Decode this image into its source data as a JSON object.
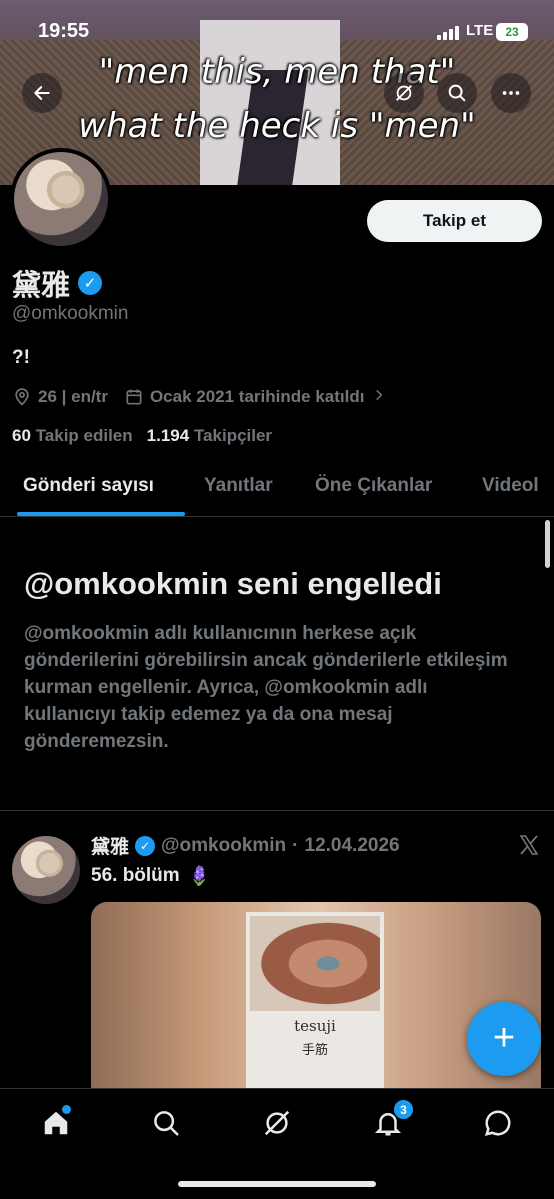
{
  "status_bar": {
    "time": "19:55",
    "network": "LTE",
    "battery": "23"
  },
  "banner": {
    "caption_line1": "\"men this, men that\"",
    "caption_line2": "what the heck is \"men\""
  },
  "profile": {
    "display_name": "黛雅",
    "handle": "@omkookmin",
    "bio": "?!",
    "location": "26 | en/tr",
    "joined": "Ocak 2021 tarihinde katıldı",
    "following_count": "60",
    "following_label": "Takip edilen",
    "followers_count": "1.194",
    "followers_label": "Takipçiler",
    "follow_button": "Takip et"
  },
  "tabs": [
    {
      "label": "Gönderi sayısı",
      "active": true
    },
    {
      "label": "Yanıtlar",
      "active": false
    },
    {
      "label": "Öne Çıkanlar",
      "active": false
    },
    {
      "label": "Videol",
      "active": false
    }
  ],
  "blocked": {
    "title": "@omkookmin seni engelledi",
    "body": "@omkookmin adlı kullanıcının herkese açık gönderilerini görebilirsin ancak gönderilerle etkileşim kurman engellenir. Ayrıca, @omkookmin adlı kullanıcıyı takip edemez ya da ona mesaj gönderemezsin."
  },
  "post": {
    "author_name": "黛雅",
    "author_handle": "@omkookmin",
    "separator": "·",
    "date": "12.04.2026",
    "text": "56. bölüm",
    "emoji": "🪻",
    "book_title": "tesuji",
    "book_subtitle": "手筋"
  },
  "fab": {
    "label": "+"
  },
  "bottom_nav": {
    "notifications_badge": "3"
  },
  "colors": {
    "accent": "#1d9bf0",
    "background": "#000000",
    "muted": "#71767b",
    "text": "#e7e9ea"
  }
}
